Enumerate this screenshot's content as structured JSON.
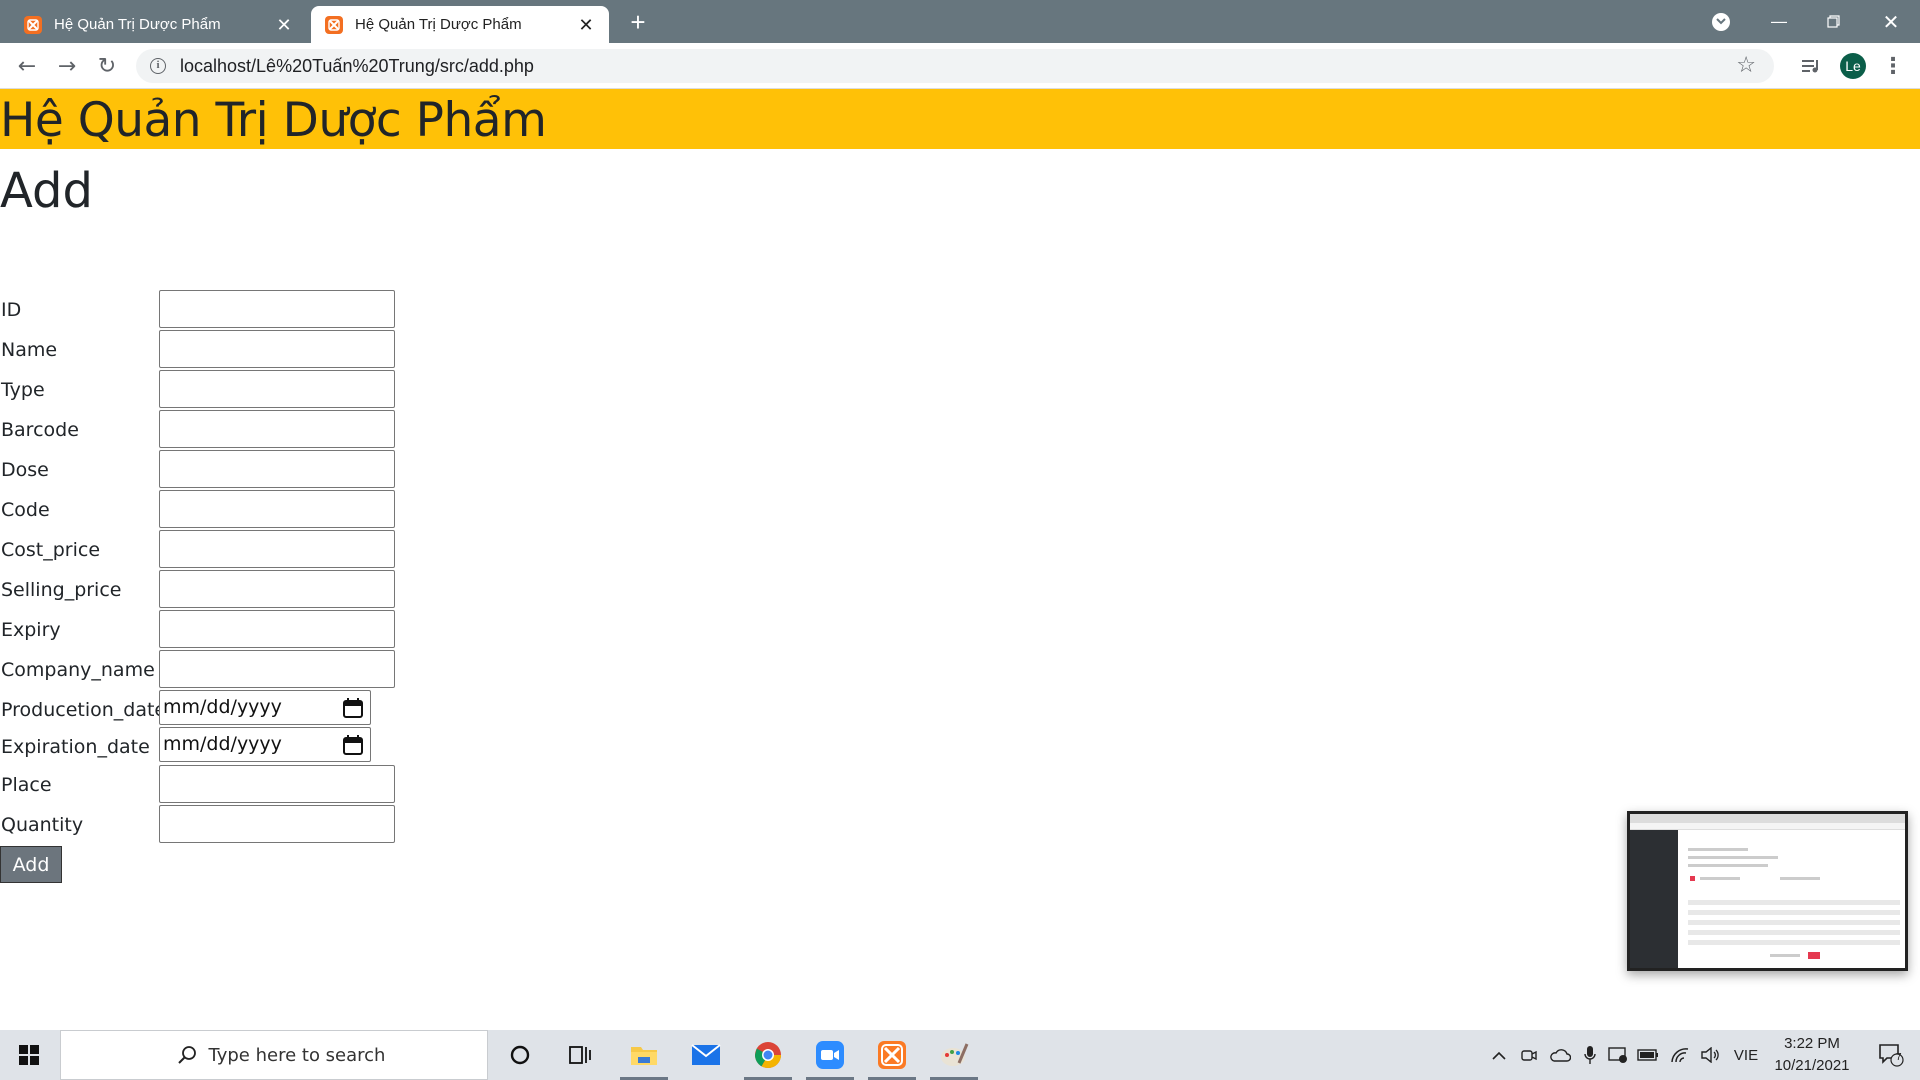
{
  "browser": {
    "tabs": [
      {
        "title": "Hệ Quản Trị Dược Phẩm",
        "active": false
      },
      {
        "title": "Hệ Quản Trị Dược Phẩm",
        "active": true
      }
    ],
    "url": "localhost/Lê%20Tuấn%20Trung/src/add.php",
    "profile_initials": "Le"
  },
  "page": {
    "header_title": "Hệ Quản Trị Dược Phẩm",
    "heading": "Add",
    "header_color": "#ffc107",
    "fields": [
      {
        "label": "ID",
        "type": "text",
        "value": ""
      },
      {
        "label": "Name",
        "type": "text",
        "value": ""
      },
      {
        "label": "Type",
        "type": "text",
        "value": ""
      },
      {
        "label": "Barcode",
        "type": "text",
        "value": ""
      },
      {
        "label": "Dose",
        "type": "text",
        "value": ""
      },
      {
        "label": "Code",
        "type": "text",
        "value": ""
      },
      {
        "label": "Cost_price",
        "type": "text",
        "value": ""
      },
      {
        "label": "Selling_price",
        "type": "text",
        "value": ""
      },
      {
        "label": "Expiry",
        "type": "text",
        "value": ""
      },
      {
        "label": "Company_name",
        "type": "text",
        "value": ""
      },
      {
        "label": "Producetion_date",
        "type": "date",
        "value": "mm/dd/yyyy"
      },
      {
        "label": "Expiration_date",
        "type": "date",
        "value": "mm/dd/yyyy"
      },
      {
        "label": "Place",
        "type": "text",
        "value": ""
      },
      {
        "label": "Quantity",
        "type": "text",
        "value": ""
      }
    ],
    "submit_label": "Add",
    "submit_color": "#6c757d"
  },
  "taskbar": {
    "search_placeholder": "Type here to search",
    "language": "VIE",
    "time": "3:22 PM",
    "date": "10/21/2021",
    "notification_count": "7",
    "apps": [
      "cortana-icon",
      "task-view-icon",
      "file-explorer-icon",
      "mail-icon",
      "chrome-icon",
      "zoom-icon",
      "xampp-icon",
      "paint-icon"
    ]
  }
}
